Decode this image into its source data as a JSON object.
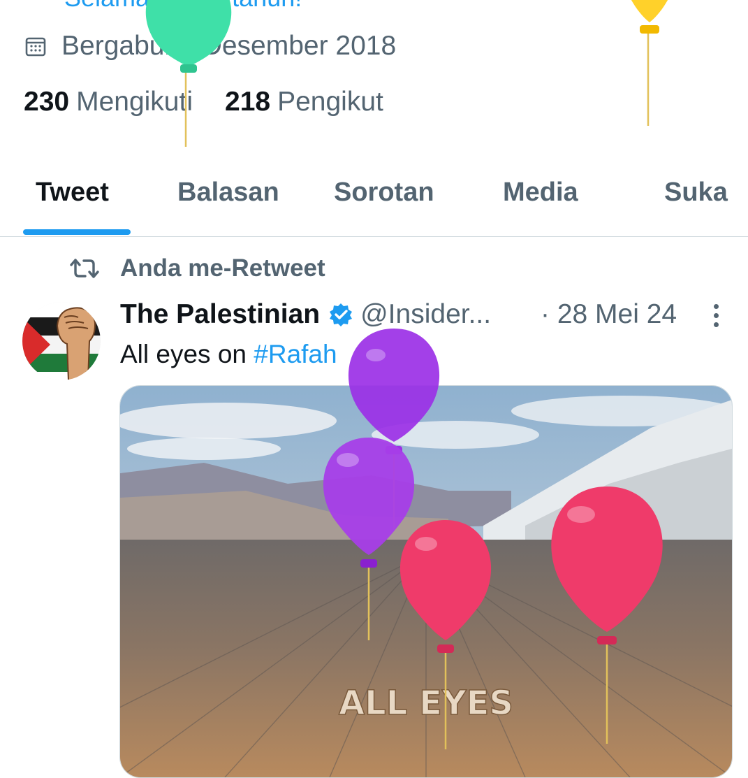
{
  "profile": {
    "partial_text": "Selamat ulang tahun!",
    "joined": "Bergabung Desember 2018",
    "following_count": "230",
    "following_label": "Mengikuti",
    "followers_count": "218",
    "followers_label": "Pengikut"
  },
  "tabs": [
    {
      "label": "Tweet",
      "active": true
    },
    {
      "label": "Balasan",
      "active": false
    },
    {
      "label": "Sorotan",
      "active": false
    },
    {
      "label": "Media",
      "active": false
    },
    {
      "label": "Suka",
      "active": false
    }
  ],
  "retweet": {
    "label": "Anda me-Retweet"
  },
  "tweet": {
    "name": "The Palestinian",
    "handle": "@Insider...",
    "date": "· 28 Mei 24",
    "text_prefix": "All eyes on ",
    "hashtag": "#Rafah",
    "media_caption": "ALL EYES"
  },
  "colors": {
    "accent": "#1d9bf0",
    "muted": "#536471",
    "text": "#0f1419",
    "balloon_green": "#3fe0a8",
    "balloon_yellow": "#ffd12a",
    "balloon_purple": "#9b30e6",
    "balloon_pink": "#ef3b6a"
  }
}
